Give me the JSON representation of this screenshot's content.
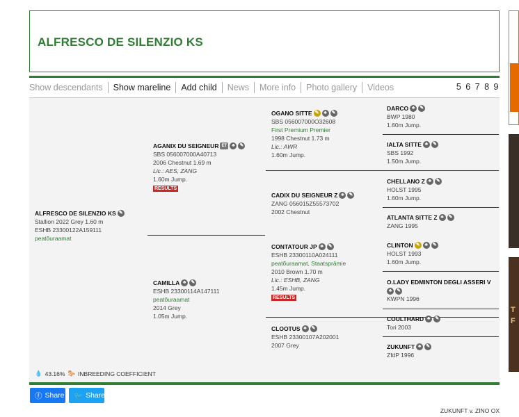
{
  "horse_title": "ALFRESCO DE SILENZIO KS",
  "tabs": [
    "Show descendants",
    "Show mareline",
    "Add child",
    "News",
    "More info",
    "Photo gallery",
    "Videos"
  ],
  "pages": "5 6 7 8 9",
  "subject": {
    "name": "ALFRESCO DE SILENZIO KS",
    "line1": "Stallion 2022 Grey 1.60 m",
    "line2": "ESHB 23300122A159111",
    "line3": "peatõuraamat"
  },
  "sire": {
    "name": "AGANIX DU SEIGNEUR",
    "reg": "SBS 056007000A40713",
    "info": "2006 Chestnut 1.69 m",
    "lic": "Lic.: AES, ZANG",
    "jump": "1.60m Jump.",
    "results": "RESULTS"
  },
  "dam": {
    "name": "CAMILLA",
    "reg": "ESHB 23300114A147111",
    "green": "peatõuraamat",
    "info": "2014 Grey",
    "jump": "1.05m Jump."
  },
  "gen3": [
    {
      "name": "OGANO SITTE",
      "reg": "SBS 056007000O32608",
      "green": "First Premium Premier",
      "info": "1998 Chestnut 1.73 m",
      "lic": "Lic.: AWR",
      "jump": "1.60m Jump."
    },
    {
      "name": "CADIX DU SEIGNEUR Z",
      "reg": "ZANG 056015Z55573702",
      "info": "2002 Chestnut"
    },
    {
      "name": "CONTATOUR JP",
      "reg": "ESHB 23300110A024111",
      "green": "peatõuraamat, Staatsprämie",
      "info": "2010 Brown 1.70 m",
      "lic": "Lic.: ESHB, ZANG",
      "jump": "1.45m Jump.",
      "results": "RESULTS"
    },
    {
      "name": "CLOOTUS",
      "reg": "ESHB 23300107A202001",
      "info": "2007 Grey"
    }
  ],
  "gen4": [
    {
      "name": "DARCO",
      "reg": "BWP 1980",
      "jump": "1.60m Jump."
    },
    {
      "name": "IALTA SITTE",
      "reg": "SBS 1992",
      "jump": "1.50m Jump."
    },
    {
      "name": "CHELLANO Z",
      "reg": "HOLST 1995",
      "jump": "1.60m Jump."
    },
    {
      "name": "ATLANTA SITTE Z",
      "reg": "ZANG 1995"
    },
    {
      "name": "CLINTON",
      "reg": "HOLST 1993",
      "jump": "1.60m Jump."
    },
    {
      "name": "O.LADY EDMINTON DEGLI ASSERI V",
      "reg": "KWPN 1996"
    },
    {
      "name": "COULTHARD",
      "reg": "Tori 2003"
    },
    {
      "name": "ZUKUNFT",
      "reg": "ZfdP 1996"
    }
  ],
  "inbreeding": {
    "value": "43.16%",
    "label": "INBREEDING COEFFICIENT"
  },
  "share": {
    "facebook": "Share",
    "twitter": "Share"
  },
  "footer_text": "ZUKUNFT v. ZINO OX",
  "ad3_text": "T\nF",
  "colors": {
    "accent_green": "#2e7d32",
    "results_red": "#c62828",
    "facebook": "#1877f2",
    "twitter": "#1da1f2"
  }
}
